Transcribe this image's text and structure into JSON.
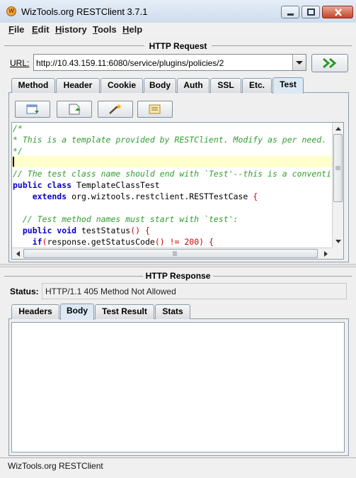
{
  "window": {
    "title": "WizTools.org RESTClient 3.7.1",
    "icon_glyph": "W"
  },
  "menu": {
    "items": [
      {
        "mnemonic": "F",
        "rest": "ile"
      },
      {
        "mnemonic": "E",
        "rest": "dit"
      },
      {
        "mnemonic": "H",
        "rest": "istory"
      },
      {
        "mnemonic": "T",
        "rest": "ools"
      },
      {
        "mnemonic": "H",
        "rest": "elp"
      }
    ]
  },
  "request": {
    "section_title": "HTTP Request",
    "url_label": "URL:",
    "url_value": "http://10.43.159.11:6080/service/plugins/policies/2",
    "tabs": [
      "Method",
      "Header",
      "Cookie",
      "Body",
      "Auth",
      "SSL",
      "Etc.",
      "Test"
    ],
    "active_tab": "Test",
    "editor_lines": [
      [
        {
          "t": "/*",
          "c": "cm"
        }
      ],
      [
        {
          "t": "* This is a template provided by RESTClient. Modify as per need.",
          "c": "cm"
        }
      ],
      [
        {
          "t": "*/",
          "c": "cm"
        }
      ],
      [
        {
          "t": "",
          "c": "tx"
        }
      ],
      [
        {
          "t": "// The test class name should end with `Test'--this is a conventi",
          "c": "cm"
        }
      ],
      [
        {
          "t": "public class ",
          "c": "kw"
        },
        {
          "t": "TemplateClassTest",
          "c": "tx"
        }
      ],
      [
        {
          "t": "    extends ",
          "c": "kw"
        },
        {
          "t": "org.wiztools.restclient.RESTTestCase ",
          "c": "tx"
        },
        {
          "t": "{",
          "c": "rd"
        }
      ],
      [
        {
          "t": "",
          "c": "tx"
        }
      ],
      [
        {
          "t": "  // Test method names must start with `test':",
          "c": "cm"
        }
      ],
      [
        {
          "t": "  public void ",
          "c": "kw"
        },
        {
          "t": "testStatus",
          "c": "tx"
        },
        {
          "t": "() {",
          "c": "rd"
        }
      ],
      [
        {
          "t": "    if",
          "c": "kw"
        },
        {
          "t": "(",
          "c": "rd"
        },
        {
          "t": "response.getStatusCode",
          "c": "tx"
        },
        {
          "t": "() != 200) {",
          "c": "rd"
        }
      ]
    ]
  },
  "response": {
    "section_title": "HTTP Response",
    "status_label": "Status:",
    "status_value": "HTTP/1.1 405 Method Not Allowed",
    "tabs": [
      "Headers",
      "Body",
      "Test Result",
      "Stats"
    ],
    "active_tab": "Body"
  },
  "statusbar": {
    "text": "WizTools.org RESTClient"
  },
  "colors": {
    "accent": "#dce9f5",
    "comment": "#2f9e2f",
    "keyword": "#0b00c8",
    "symbol": "#d40000",
    "go_arrow": "#2a9a2a"
  }
}
